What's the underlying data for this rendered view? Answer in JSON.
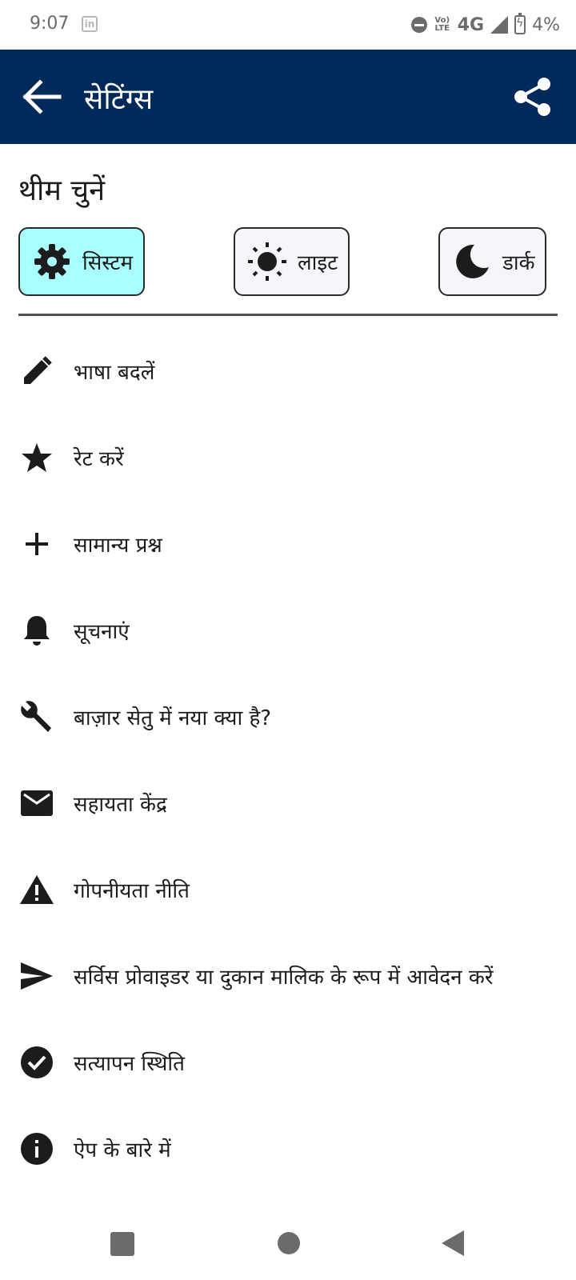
{
  "status_bar": {
    "time": "9:07",
    "app_icon": "in",
    "volte": "Vo) LTE",
    "network": "4G",
    "battery": "4%"
  },
  "app_bar": {
    "title": "सेटिंग्स",
    "background_color": "#012a5a",
    "back_icon": "arrow-left-icon",
    "share_icon": "share-icon"
  },
  "theme_section": {
    "title": "थीम चुनें",
    "options": [
      {
        "label": "सिस्टम",
        "icon": "gear-icon",
        "selected": true
      },
      {
        "label": "लाइट",
        "icon": "sun-icon",
        "selected": false
      },
      {
        "label": "डार्क",
        "icon": "moon-icon",
        "selected": false
      }
    ],
    "selected_color": "#aaffff"
  },
  "menu": {
    "items": [
      {
        "label": "भाषा बदलें",
        "icon": "pencil-icon"
      },
      {
        "label": "रेट करें",
        "icon": "star-icon"
      },
      {
        "label": "सामान्य प्रश्न",
        "icon": "plus-icon"
      },
      {
        "label": "सूचनाएं",
        "icon": "bell-icon"
      },
      {
        "label": "बाज़ार सेतु में नया क्या है?",
        "icon": "wrench-icon"
      },
      {
        "label": "सहायता केंद्र",
        "icon": "mail-icon"
      },
      {
        "label": "गोपनीयता नीति",
        "icon": "warning-icon"
      },
      {
        "label": "सर्विस प्रोवाइडर या दुकान मालिक के रूप में आवेदन करें",
        "icon": "send-icon"
      },
      {
        "label": "सत्यापन स्थिति",
        "icon": "check-circle-icon"
      },
      {
        "label": "ऐप के बारे में",
        "icon": "info-icon"
      }
    ]
  }
}
